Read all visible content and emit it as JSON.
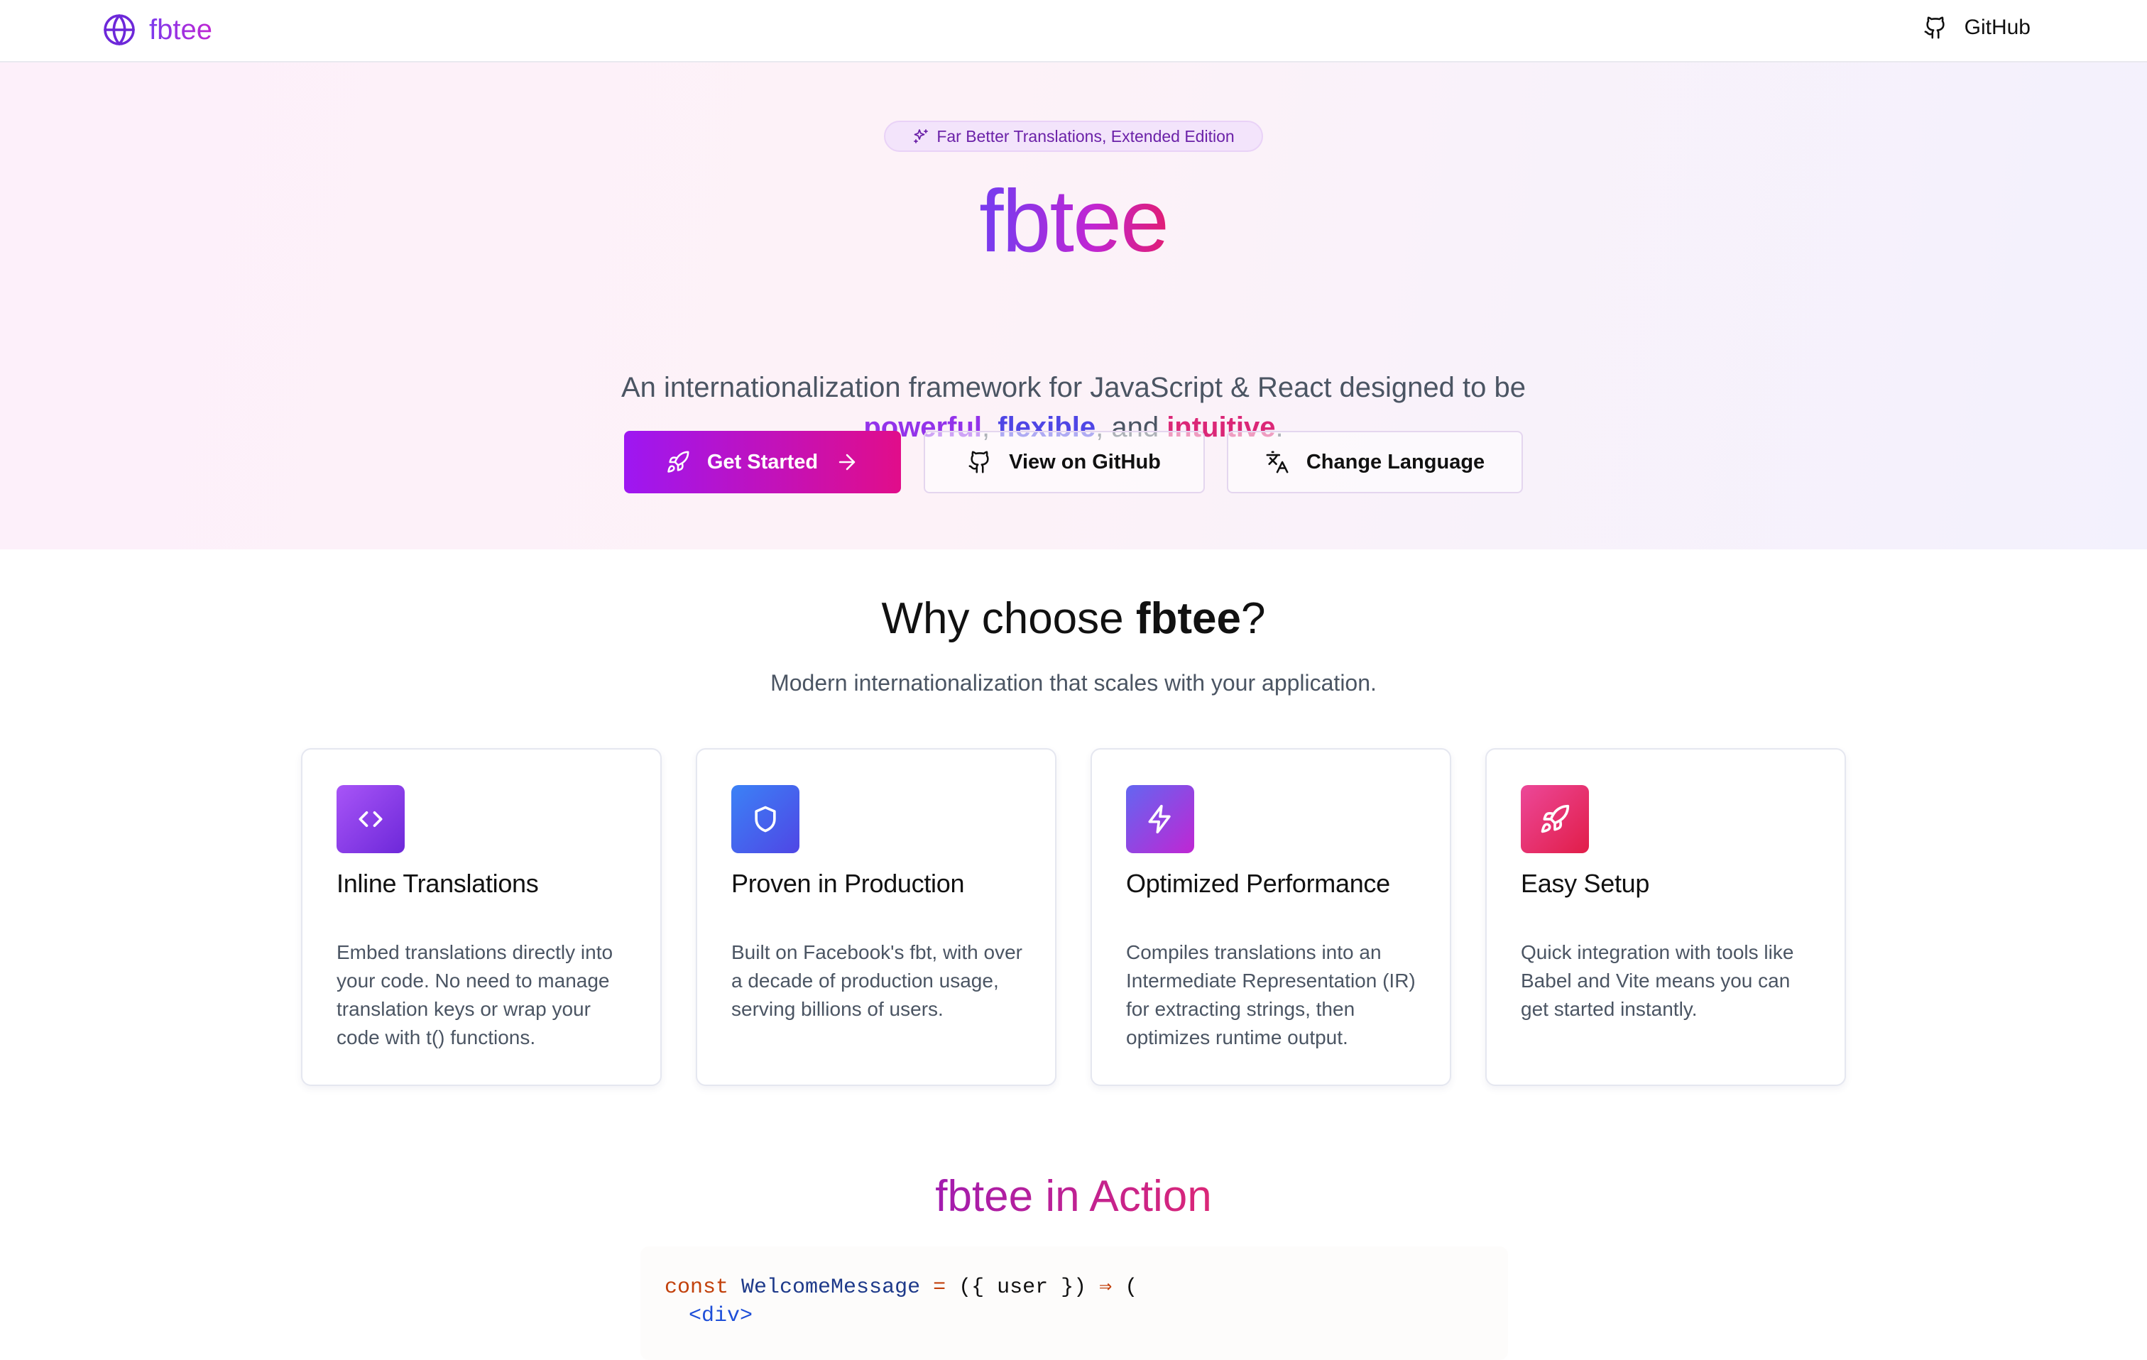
{
  "header": {
    "logo_text": "fbtee",
    "github_label": "GitHub",
    "icons": {
      "logo": "globe-icon",
      "github": "github-icon"
    }
  },
  "hero": {
    "badge": "Far Better Translations, Extended Edition",
    "title": "fbtee",
    "subtitle_line1": "An internationalization framework for JavaScript & React designed to be",
    "highlight1": "powerful",
    "sep1": ",",
    "highlight2": "flexible",
    "sep2": ", and",
    "highlight3": "intuitive",
    "end": ".",
    "buttons": {
      "get_started": "Get Started",
      "view_github": "View on GitHub",
      "change_language": "Change Language"
    }
  },
  "features": {
    "title_prefix": "Why choose",
    "title_brand": "fbtee",
    "title_suffix": "?",
    "subtitle": "Modern internationalization that scales with your application.",
    "cards": [
      {
        "icon": "code-icon",
        "title": "Inline Translations",
        "desc": "Embed translations directly into your code. No need to manage translation keys or wrap your code with t() functions."
      },
      {
        "icon": "shield-icon",
        "title": "Proven in Production",
        "desc": "Built on Facebook's fbt, with over a decade of production usage, serving billions of users."
      },
      {
        "icon": "lightning-icon",
        "title": "Optimized Performance",
        "desc": "Compiles translations into an Intermediate Representation (IR) for extracting strings, then optimizes runtime output."
      },
      {
        "icon": "rocket-icon",
        "title": "Easy Setup",
        "desc": "Quick integration with tools like Babel and Vite means you can get started instantly."
      }
    ]
  },
  "action": {
    "title": "fbtee in Action",
    "code": {
      "l1_kw": "const",
      "l1_name": "WelcomeMessage",
      "l1_eq": "=",
      "l1_args": "({ user })",
      "l1_arrow": "⇒",
      "l1_paren": "(",
      "l2_tag": "<div>"
    }
  },
  "colors": {
    "brand_purple": "#7c3aed",
    "brand_pink": "#db2777",
    "primary_button_start": "#9d17f2",
    "primary_button_end": "#e10d8a"
  }
}
